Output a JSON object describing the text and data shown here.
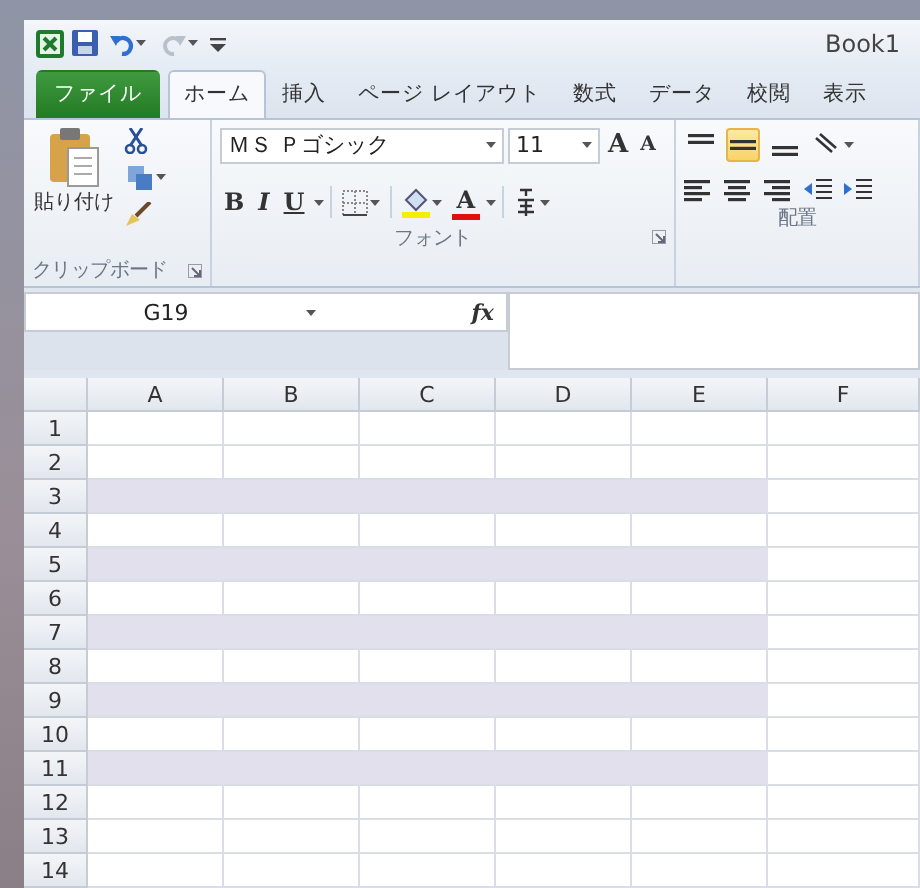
{
  "window": {
    "title": "Book1"
  },
  "tabs": [
    {
      "label": "ファイル",
      "kind": "file",
      "selected": false
    },
    {
      "label": "ホーム",
      "kind": "tab",
      "selected": true
    },
    {
      "label": "挿入",
      "kind": "tab",
      "selected": false
    },
    {
      "label": "ページ レイアウト",
      "kind": "tab",
      "selected": false
    },
    {
      "label": "数式",
      "kind": "tab",
      "selected": false
    },
    {
      "label": "データ",
      "kind": "tab",
      "selected": false
    },
    {
      "label": "校閲",
      "kind": "tab",
      "selected": false
    },
    {
      "label": "表示",
      "kind": "tab",
      "selected": false
    }
  ],
  "clipboard": {
    "paste_label": "貼り付け",
    "group_label": "クリップボード"
  },
  "font": {
    "name": "ＭＳ Ｐゴシック",
    "size": "11",
    "grow": "A",
    "shrink": "A",
    "bold": "B",
    "italic": "I",
    "underline": "U",
    "font_color": "A",
    "group_label": "フォント"
  },
  "alignment": {
    "vertical": [
      {
        "kind": "top",
        "selected": false
      },
      {
        "kind": "middle",
        "selected": true
      },
      {
        "kind": "bottom",
        "selected": false
      }
    ],
    "group_label": "配置"
  },
  "formula_bar": {
    "name_box": "G19",
    "function_label": "fx"
  },
  "sheet": {
    "columns": [
      "A",
      "B",
      "C",
      "D",
      "E",
      "F"
    ],
    "rows": [
      {
        "label": "1",
        "shaded": false
      },
      {
        "label": "2",
        "shaded": false
      },
      {
        "label": "3",
        "shaded": true
      },
      {
        "label": "4",
        "shaded": false
      },
      {
        "label": "5",
        "shaded": true
      },
      {
        "label": "6",
        "shaded": false
      },
      {
        "label": "7",
        "shaded": true
      },
      {
        "label": "8",
        "shaded": false
      },
      {
        "label": "9",
        "shaded": true
      },
      {
        "label": "10",
        "shaded": false
      },
      {
        "label": "11",
        "shaded": true
      },
      {
        "label": "12",
        "shaded": false
      },
      {
        "label": "13",
        "shaded": false
      },
      {
        "label": "14",
        "shaded": false
      }
    ]
  }
}
